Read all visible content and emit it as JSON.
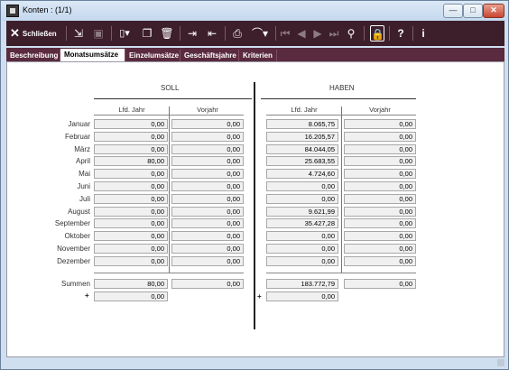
{
  "window": {
    "title": "Konten :  (1/1)"
  },
  "titlebar_buttons": {
    "min": "—",
    "max": "□",
    "close": "✕"
  },
  "toolbar": {
    "close_label": "Schließen"
  },
  "tabs": [
    "Beschreibung",
    "Monatsumsätze",
    "Einzelumsätze",
    "Geschäftsjahre",
    "Kriterien"
  ],
  "active_tab": "Monatsumsätze",
  "soll": {
    "title": "SOLL",
    "col_current": "Lfd. Jahr",
    "col_previous": "Vorjahr"
  },
  "haben": {
    "title": "HABEN",
    "col_current": "Lfd. Jahr",
    "col_previous": "Vorjahr"
  },
  "months": [
    "Januar",
    "Februar",
    "März",
    "April",
    "Mai",
    "Juni",
    "Juli",
    "August",
    "September",
    "Oktober",
    "November",
    "Dezember"
  ],
  "soll_current": [
    "0,00",
    "0,00",
    "0,00",
    "80,00",
    "0,00",
    "0,00",
    "0,00",
    "0,00",
    "0,00",
    "0,00",
    "0,00",
    "0,00"
  ],
  "soll_previous": [
    "0,00",
    "0,00",
    "0,00",
    "0,00",
    "0,00",
    "0,00",
    "0,00",
    "0,00",
    "0,00",
    "0,00",
    "0,00",
    "0,00"
  ],
  "haben_current": [
    "8.065,75",
    "16.205,57",
    "84.044,05",
    "25.683,55",
    "4.724,60",
    "0,00",
    "0,00",
    "9.621,99",
    "35.427,28",
    "0,00",
    "0,00",
    "0,00"
  ],
  "haben_previous": [
    "0,00",
    "0,00",
    "0,00",
    "0,00",
    "0,00",
    "0,00",
    "0,00",
    "0,00",
    "0,00",
    "0,00",
    "0,00",
    "0,00"
  ],
  "sums": {
    "label": "Summen",
    "soll_current": "80,00",
    "soll_previous": "0,00",
    "haben_current": "183.772,79",
    "haben_previous": "0,00",
    "plus_symbol": "+",
    "soll_plus": "0,00",
    "haben_plus": "0,00"
  },
  "colors": {
    "toolbar_bg": "#3d1e2b",
    "tabs_bg": "#5a2b3e"
  }
}
